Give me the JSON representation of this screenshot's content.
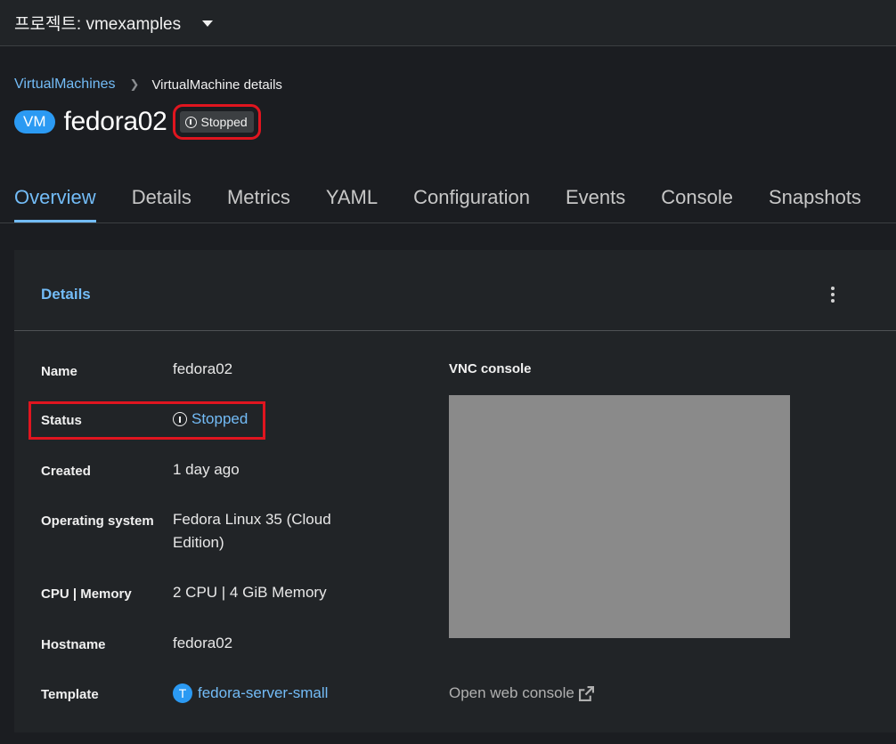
{
  "topbar": {
    "project_label": "프로젝트: vmexamples"
  },
  "breadcrumb": {
    "parent": "VirtualMachines",
    "current": "VirtualMachine details"
  },
  "title": {
    "badge": "VM",
    "name": "fedora02",
    "status": "Stopped"
  },
  "tabs": [
    "Overview",
    "Details",
    "Metrics",
    "YAML",
    "Configuration",
    "Events",
    "Console",
    "Snapshots"
  ],
  "card": {
    "title": "Details",
    "fields": {
      "name": {
        "label": "Name",
        "value": "fedora02"
      },
      "status": {
        "label": "Status",
        "value": "Stopped"
      },
      "created": {
        "label": "Created",
        "value": "1 day ago"
      },
      "os": {
        "label": "Operating system",
        "value": "Fedora Linux 35 (Cloud Edition)"
      },
      "cpu": {
        "label": "CPU | Memory",
        "value": "2 CPU | 4 GiB Memory"
      },
      "hostname": {
        "label": "Hostname",
        "value": "fedora02"
      },
      "template": {
        "label": "Template",
        "badge": "T",
        "value": "fedora-server-small"
      }
    },
    "vnc_title": "VNC console",
    "web_console": "Open web console"
  },
  "colors": {
    "link": "#73bcf7",
    "badge": "#2b9af3",
    "highlight": "#e0151f",
    "vnc_placeholder": "#8a8a8a"
  }
}
